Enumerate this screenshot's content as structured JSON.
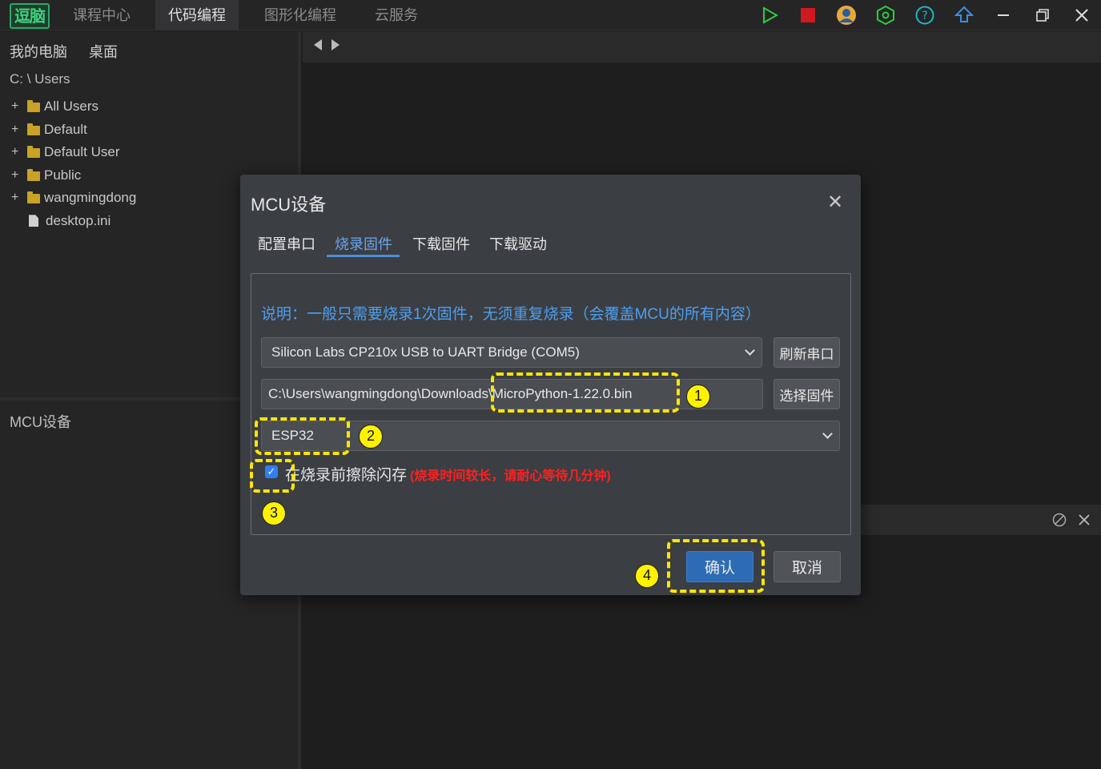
{
  "app": {
    "logo_text": "逗脑",
    "nav_tabs": [
      "课程中心",
      "代码编程",
      "图形化编程",
      "云服务"
    ],
    "active_tab": "代码编程",
    "toolbar_icons": [
      "run-icon",
      "stop-icon",
      "user-avatar-icon",
      "settings-icon",
      "help-icon",
      "upload-icon",
      "minimize-icon",
      "restore-icon",
      "close-icon"
    ]
  },
  "sidebar": {
    "tabs": [
      "我的电脑",
      "桌面"
    ],
    "path": "C: \\ Users",
    "items": [
      {
        "label": "All Users",
        "type": "folder"
      },
      {
        "label": "Default",
        "type": "folder"
      },
      {
        "label": "Default User",
        "type": "folder"
      },
      {
        "label": "Public",
        "type": "folder"
      },
      {
        "label": "wangmingdong",
        "type": "folder"
      },
      {
        "label": "desktop.ini",
        "type": "file"
      }
    ],
    "lower_title": "MCU设备"
  },
  "dialog": {
    "title": "MCU设备",
    "close_symbol": "✕",
    "tabs": [
      "配置串口",
      "烧录固件",
      "下载固件",
      "下载驱动"
    ],
    "active_tab": "烧录固件",
    "note": "说明：一般只需要烧录1次固件，无须重复烧录（会覆盖MCU的所有内容）",
    "port_select": "Silicon Labs CP210x USB to UART Bridge (COM5)",
    "refresh_button": "刷新串口",
    "firmware_path": "C:\\Users\\wangmingdong\\Downloads\\MicroPython-1.22.0.bin",
    "choose_firmware_button": "选择固件",
    "chip_select": "ESP32",
    "erase_checkbox_checked": true,
    "erase_label": "在烧录前擦除闪存",
    "erase_warning": "(烧录时间较长，请耐心等待几分钟)",
    "confirm_button": "确认",
    "cancel_button": "取消"
  },
  "annotations": {
    "badges": [
      "1",
      "2",
      "3",
      "4"
    ],
    "highlight_color": "#ffe600"
  }
}
